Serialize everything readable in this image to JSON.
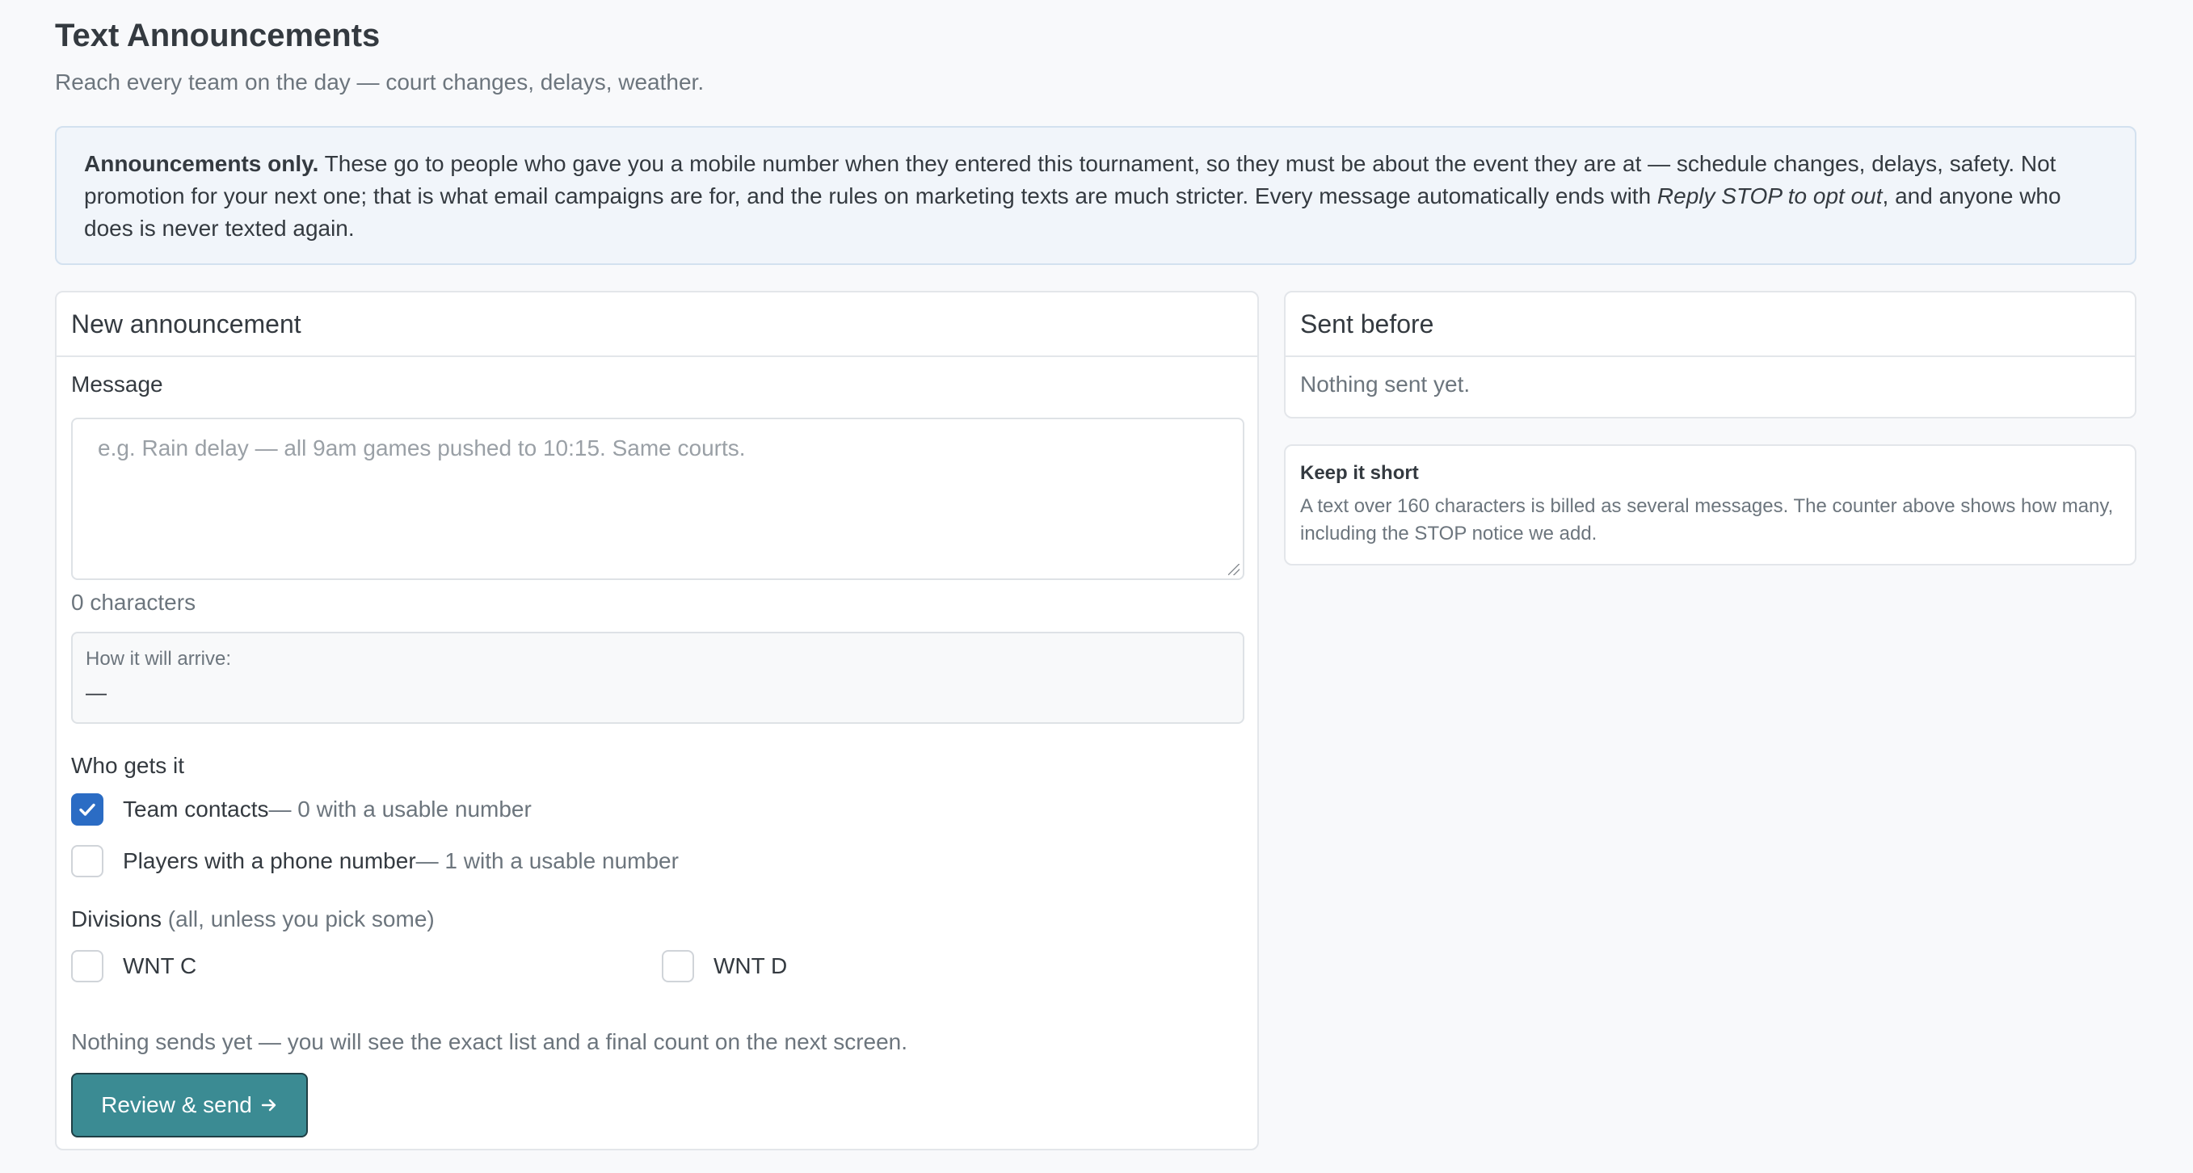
{
  "page": {
    "title": "Text Announcements",
    "subtitle": "Reach every team on the day — court changes, delays, weather."
  },
  "notice": {
    "lead": "Announcements only.",
    "body_1": " These go to people who gave you a mobile number when they entered this tournament, so they must be about the event they are at — schedule changes, delays, safety. Not promotion for your next one; that is what email campaigns are for, and the rules on marketing texts are much stricter. Every message automatically ends with ",
    "emphasis": "Reply STOP to opt out",
    "body_2": ", and anyone who does is never texted again."
  },
  "new_announcement": {
    "header": "New announcement",
    "message_label": "Message",
    "message_value": "",
    "message_placeholder": "e.g. Rain delay — all 9am games pushed to 10:15. Same courts.",
    "char_count": "0 characters",
    "preview_label": "How it will arrive:",
    "preview_value": "—",
    "recipients_label": "Who gets it",
    "recipients": [
      {
        "label": "Team contacts",
        "detail": " — 0 with a usable number",
        "checked": true
      },
      {
        "label": "Players with a phone number",
        "detail": " — 1 with a usable number",
        "checked": false
      }
    ],
    "divisions_label": "Divisions",
    "divisions_hint": " (all, unless you pick some)",
    "divisions": [
      {
        "label": "WNT C",
        "checked": false
      },
      {
        "label": "WNT D",
        "checked": false
      }
    ],
    "footer_note": "Nothing sends yet — you will see the exact list and a final count on the next screen.",
    "review_button": "Review & send",
    "review_button_icon": "arrow-right-icon"
  },
  "sent_before": {
    "header": "Sent before",
    "empty_text": "Nothing sent yet."
  },
  "tip": {
    "title": "Keep it short",
    "body": "A text over 160 characters is billed as several messages. The counter above shows how many, including the STOP notice we add."
  },
  "colors": {
    "accent": "#3b8b93",
    "checkbox_checked": "#2b6cc4",
    "notice_bg": "#f1f5fa"
  }
}
